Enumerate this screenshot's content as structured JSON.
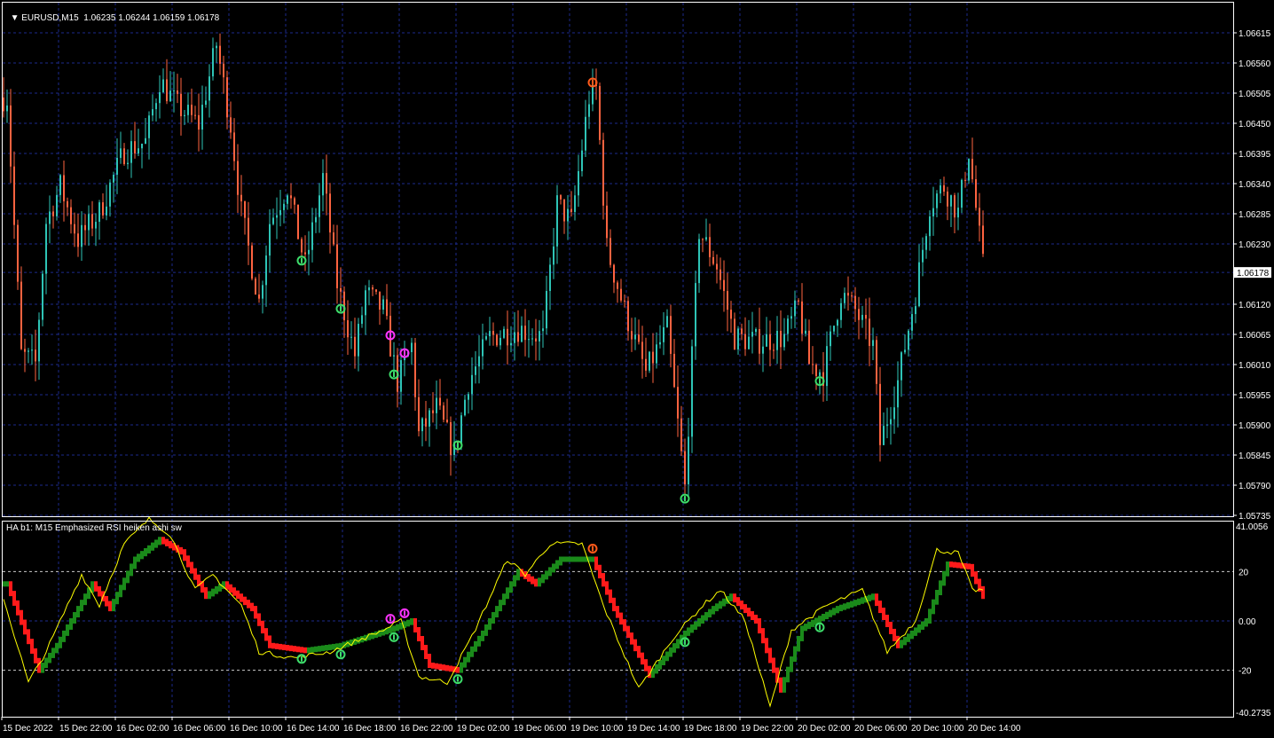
{
  "window": {
    "symbol_timeframe": "EURUSD,M15",
    "ohlc": "1.06235 1.06244 1.06159 1.06178"
  },
  "indicator": {
    "title": "HA b1: M15 Emphasized RSI heiken ashi sw",
    "scale_max": "41.0056",
    "scale_min": "-40.2735"
  },
  "price_axis": [
    "1.06615",
    "1.06560",
    "1.06505",
    "1.06450",
    "1.06395",
    "1.06340",
    "1.06285",
    "1.06230",
    "1.06120",
    "1.06065",
    "1.06010",
    "1.05955",
    "1.05900",
    "1.05845",
    "1.05790",
    "1.05735"
  ],
  "current_price": "1.06178",
  "indicator_axis": [
    "20",
    "0.00",
    "-20"
  ],
  "time_axis": [
    "15 Dec 2022",
    "15 Dec 22:00",
    "16 Dec 02:00",
    "16 Dec 06:00",
    "16 Dec 10:00",
    "16 Dec 14:00",
    "16 Dec 18:00",
    "16 Dec 22:00",
    "19 Dec 02:00",
    "19 Dec 06:00",
    "19 Dec 10:00",
    "19 Dec 14:00",
    "19 Dec 18:00",
    "19 Dec 22:00",
    "20 Dec 02:00",
    "20 Dec 06:00",
    "20 Dec 10:00",
    "20 Dec 14:00"
  ],
  "colors": {
    "bull": "#2ec4b6",
    "bear": "#ff6340",
    "ha_up": "#1a8a1a",
    "ha_down": "#ff1a1a",
    "rsi": "#ffff00",
    "grid": "#1c2a8c",
    "arrow_up": "#3ddc6a",
    "arrow_magenta": "#ff33ff",
    "arrow_orange": "#ff5a1a"
  },
  "chart_data": {
    "type": "candlestick",
    "timeframe": "M15",
    "ylim": [
      1.05735,
      1.06615
    ],
    "price_keypoints": [
      [
        1,
        1.06497
      ],
      [
        5,
        1.06028
      ],
      [
        9,
        1.06012
      ],
      [
        12,
        1.0627
      ],
      [
        16,
        1.06335
      ],
      [
        21,
        1.06238
      ],
      [
        27,
        1.06287
      ],
      [
        34,
        1.064
      ],
      [
        40,
        1.06416
      ],
      [
        44,
        1.06529
      ],
      [
        49,
        1.06481
      ],
      [
        55,
        1.06448
      ],
      [
        60,
        1.06594
      ],
      [
        64,
        1.06448
      ],
      [
        67,
        1.06287
      ],
      [
        72,
        1.06125
      ],
      [
        75,
        1.0627
      ],
      [
        80,
        1.06335
      ],
      [
        85,
        1.0619
      ],
      [
        90,
        1.06351
      ],
      [
        94,
        1.06157
      ],
      [
        99,
        1.06028
      ],
      [
        102,
        1.06141
      ],
      [
        107,
        1.06109
      ],
      [
        111,
        1.05979
      ],
      [
        115,
        1.06044
      ],
      [
        117,
        1.05882
      ],
      [
        122,
        1.05931
      ],
      [
        127,
        1.0585
      ],
      [
        131,
        1.05979
      ],
      [
        137,
        1.0606
      ],
      [
        145,
        1.06076
      ],
      [
        152,
        1.0606
      ],
      [
        156,
        1.06303
      ],
      [
        160,
        1.0627
      ],
      [
        165,
        1.06497
      ],
      [
        167,
        1.06513
      ],
      [
        170,
        1.06222
      ],
      [
        175,
        1.06109
      ],
      [
        181,
        1.05995
      ],
      [
        187,
        1.06076
      ],
      [
        192,
        1.05785
      ],
      [
        196,
        1.06254
      ],
      [
        201,
        1.0619
      ],
      [
        206,
        1.0606
      ],
      [
        212,
        1.06052
      ],
      [
        220,
        1.0606
      ],
      [
        224,
        1.06117
      ],
      [
        227,
        1.06012
      ],
      [
        231,
        1.05995
      ],
      [
        236,
        1.06141
      ],
      [
        240,
        1.06109
      ],
      [
        245,
        1.06044
      ],
      [
        247,
        1.05866
      ],
      [
        252,
        1.05979
      ],
      [
        257,
        1.06141
      ],
      [
        261,
        1.06303
      ],
      [
        265,
        1.06335
      ],
      [
        269,
        1.06287
      ],
      [
        272,
        1.064
      ],
      [
        276,
        1.0619
      ]
    ],
    "indicator_keypoints": [
      [
        1,
        15
      ],
      [
        10,
        -20
      ],
      [
        15,
        -10
      ],
      [
        25,
        15
      ],
      [
        30,
        5
      ],
      [
        37,
        25
      ],
      [
        44,
        33
      ],
      [
        50,
        28
      ],
      [
        57,
        10
      ],
      [
        62,
        15
      ],
      [
        70,
        5
      ],
      [
        75,
        -10
      ],
      [
        85,
        -12
      ],
      [
        95,
        -10
      ],
      [
        110,
        -3
      ],
      [
        115,
        0
      ],
      [
        120,
        -18
      ],
      [
        128,
        -20
      ],
      [
        135,
        -5
      ],
      [
        145,
        20
      ],
      [
        150,
        15
      ],
      [
        157,
        25
      ],
      [
        166,
        25
      ],
      [
        172,
        5
      ],
      [
        182,
        -22
      ],
      [
        192,
        -5
      ],
      [
        200,
        5
      ],
      [
        205,
        10
      ],
      [
        212,
        0
      ],
      [
        219,
        -28
      ],
      [
        225,
        -3
      ],
      [
        235,
        5
      ],
      [
        245,
        10
      ],
      [
        252,
        -10
      ],
      [
        260,
        0
      ],
      [
        266,
        23
      ],
      [
        272,
        22
      ],
      [
        276,
        10
      ]
    ],
    "indicator_levels": [
      20,
      0,
      -20
    ],
    "signals": [
      {
        "bar": 84,
        "type": "up"
      },
      {
        "bar": 95,
        "type": "up"
      },
      {
        "bar": 110,
        "type": "up"
      },
      {
        "bar": 128,
        "type": "up"
      },
      {
        "bar": 192,
        "type": "up"
      },
      {
        "bar": 230,
        "type": "up"
      },
      {
        "bar": 109,
        "type": "magenta"
      },
      {
        "bar": 113,
        "type": "magenta"
      },
      {
        "bar": 166,
        "type": "orange"
      }
    ]
  }
}
